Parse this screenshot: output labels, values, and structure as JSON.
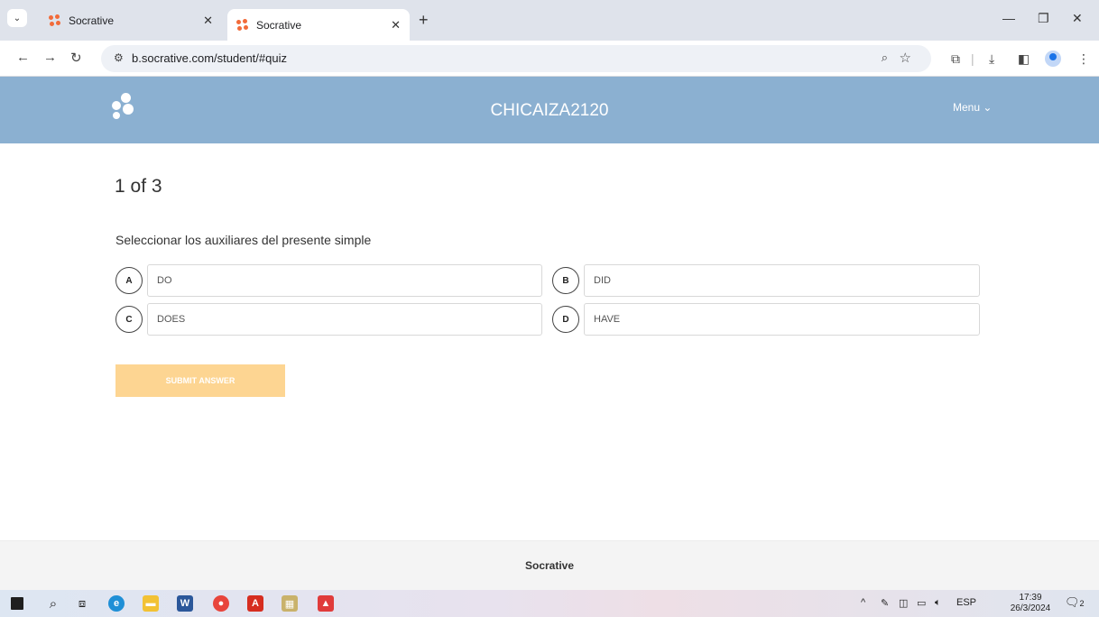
{
  "browser": {
    "tabs": [
      {
        "title": "Socrative",
        "active": false
      },
      {
        "title": "Socrative",
        "active": true
      }
    ],
    "url": "b.socrative.com/student/#quiz"
  },
  "header": {
    "room_name": "CHICAIZA2120",
    "menu_label": "Menu"
  },
  "quiz": {
    "progress": "1 of 3",
    "question": "Seleccionar los auxiliares del presente simple",
    "choices": [
      {
        "letter": "A",
        "text": "DO"
      },
      {
        "letter": "B",
        "text": "DID"
      },
      {
        "letter": "C",
        "text": "DOES"
      },
      {
        "letter": "D",
        "text": "HAVE"
      }
    ],
    "submit_label": "SUBMIT ANSWER"
  },
  "footer": {
    "brand": "Socrative"
  },
  "taskbar": {
    "language": "ESP",
    "time": "17:39",
    "date": "26/3/2024",
    "notification_count": "2"
  },
  "colors": {
    "header_bg": "#8bb0d1",
    "submit_bg": "#fdd592",
    "favicon": "#f26b3a"
  }
}
